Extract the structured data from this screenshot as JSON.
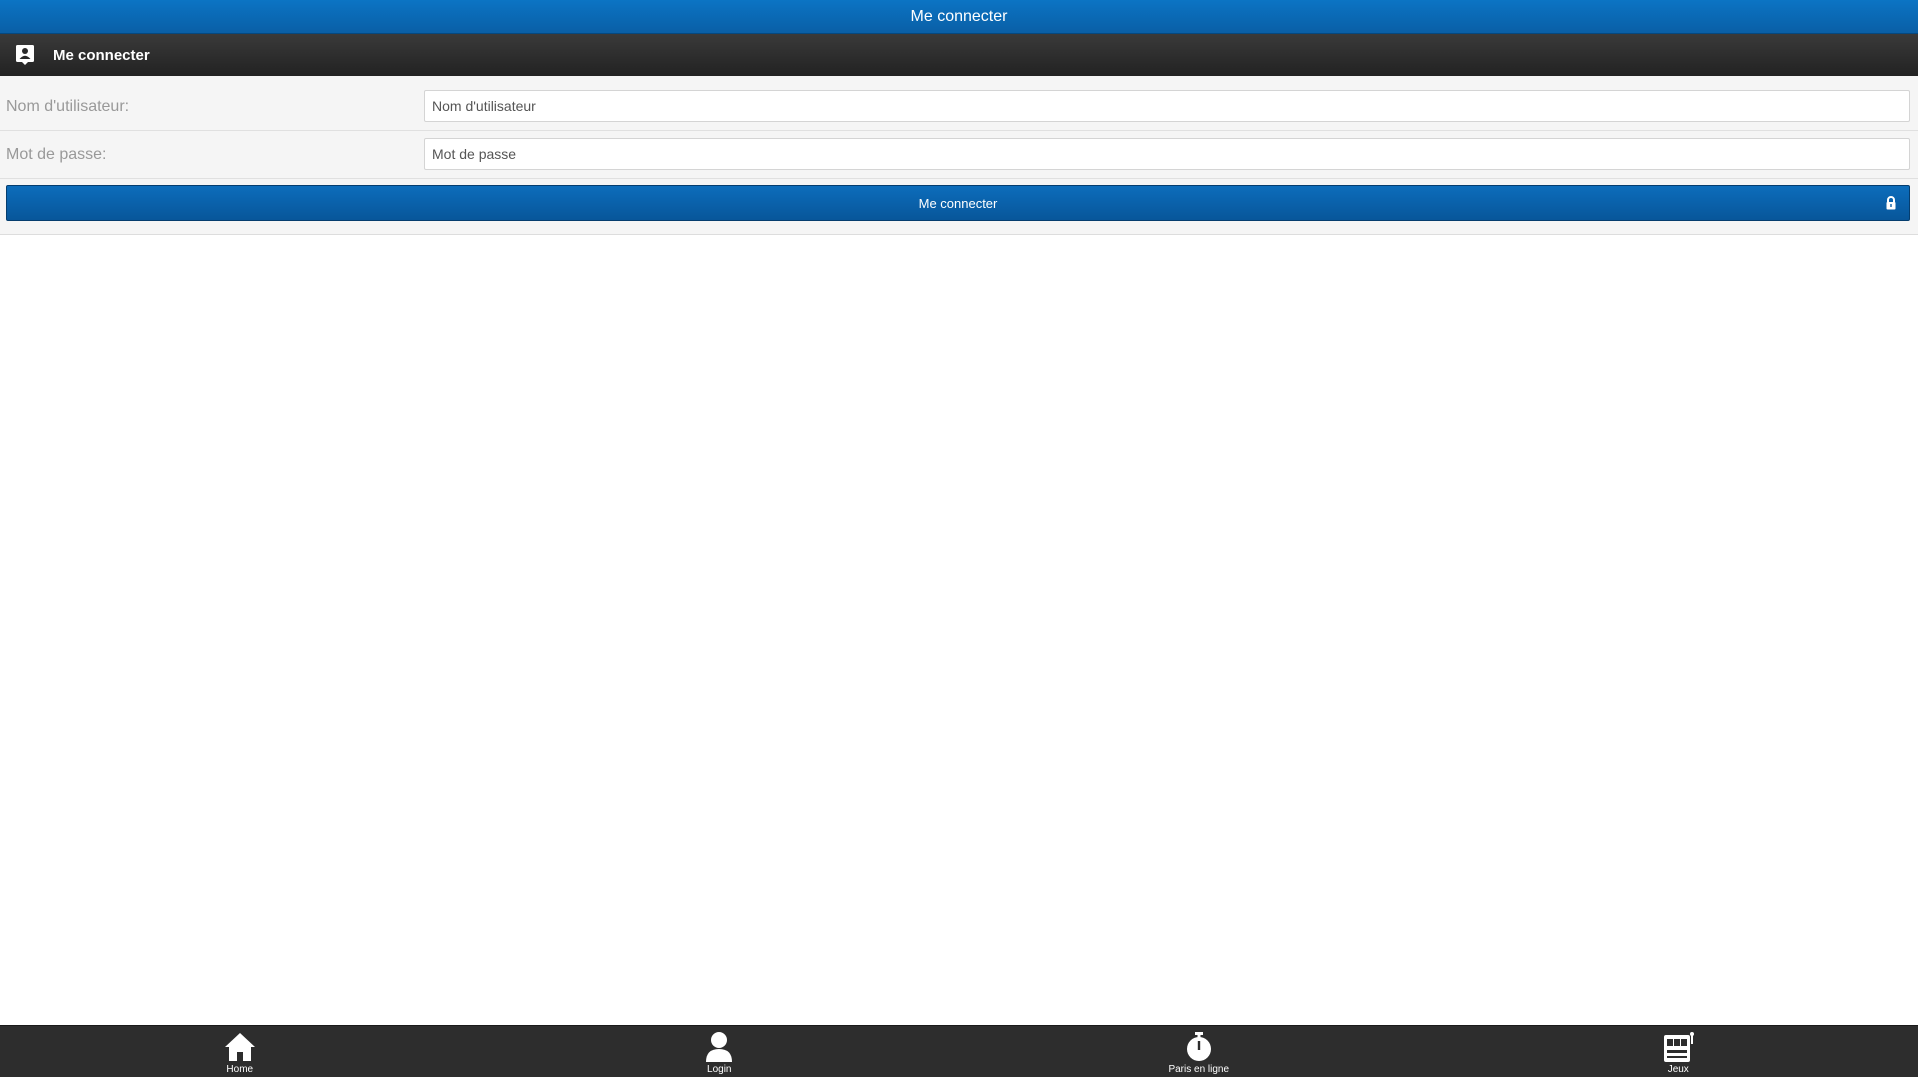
{
  "topbar": {
    "title": "Me connecter"
  },
  "section": {
    "title": "Me connecter",
    "icon": "login-user-icon"
  },
  "form": {
    "username": {
      "label": "Nom d'utilisateur:",
      "placeholder": "Nom d'utilisateur"
    },
    "password": {
      "label": "Mot de passe:",
      "placeholder": "Mot de passe"
    },
    "submit": {
      "label": "Me connecter",
      "icon": "lock-icon"
    }
  },
  "bottom_nav": {
    "items": [
      {
        "label": "Home",
        "icon": "home-icon"
      },
      {
        "label": "Login",
        "icon": "user-icon"
      },
      {
        "label": "Paris en ligne",
        "icon": "stopwatch-icon"
      },
      {
        "label": "Jeux",
        "icon": "slot-machine-icon"
      }
    ]
  },
  "colors": {
    "accent_blue": "#0a63ab",
    "header_dark": "#2d2d2d",
    "form_bg": "#f5f5f5"
  }
}
